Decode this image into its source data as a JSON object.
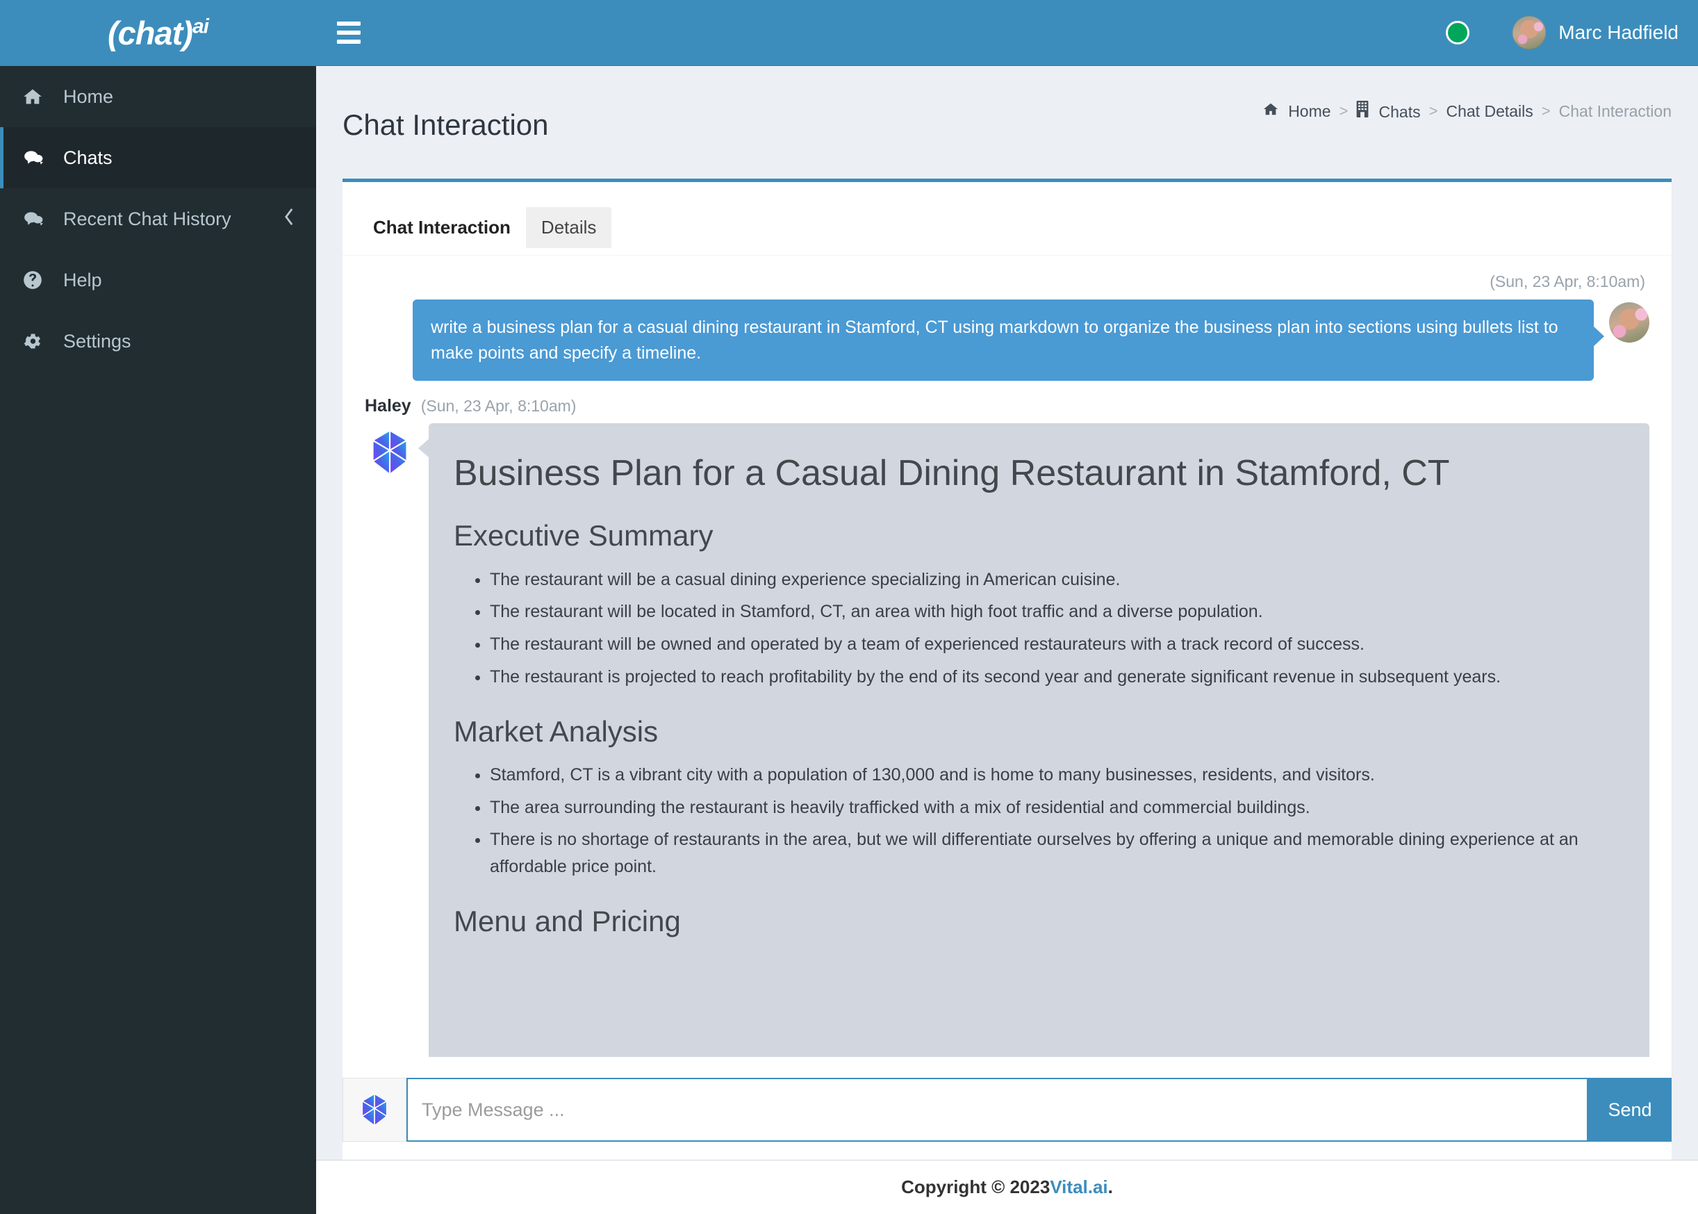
{
  "brand": {
    "logo_prefix": "(chat)",
    "logo_suffix": "ai"
  },
  "colors": {
    "header_blue": "#3c8dbc",
    "sidebar_dark": "#222d32",
    "sidebar_active": "#1e282c",
    "status_green": "#00a65a",
    "bubble_out": "#4a9ad4",
    "bubble_in": "#d2d6de",
    "page_bg": "#ecf0f5",
    "link_blue": "#3c8dbc"
  },
  "sidebar": {
    "items": [
      {
        "label": "Home",
        "icon": "home-icon",
        "active": false,
        "chevron": false
      },
      {
        "label": "Chats",
        "icon": "chats-icon",
        "active": true,
        "chevron": false
      },
      {
        "label": "Recent Chat History",
        "icon": "chat-history-icon",
        "active": false,
        "chevron": true
      },
      {
        "label": "Help",
        "icon": "help-circle-icon",
        "active": false,
        "chevron": false
      },
      {
        "label": "Settings",
        "icon": "gear-icon",
        "active": false,
        "chevron": false
      }
    ]
  },
  "topbar": {
    "menu_toggle": "hamburger-icon",
    "status": "online",
    "user_name": "Marc Hadfield"
  },
  "page": {
    "title": "Chat Interaction",
    "breadcrumb": [
      {
        "label": "Home",
        "icon": "home-icon",
        "current": false
      },
      {
        "label": "Chats",
        "icon": "building-icon",
        "current": false
      },
      {
        "label": "Chat Details",
        "icon": "",
        "current": false
      },
      {
        "label": "Chat Interaction",
        "icon": "",
        "current": true
      }
    ],
    "separator": ">"
  },
  "tabs": [
    {
      "label": "Chat Interaction",
      "active": true
    },
    {
      "label": "Details",
      "active": false
    }
  ],
  "conversation": {
    "user_message": {
      "timestamp": "(Sun, 23 Apr, 8:10am)",
      "text": "write a business plan for a casual dining restaurant in Stamford, CT using markdown to organize the business plan into sections using bullets list to make points and specify a timeline."
    },
    "bot_message": {
      "sender": "Haley",
      "timestamp": "(Sun, 23 Apr, 8:10am)",
      "avatar": "haley-polyhedron-logo",
      "title": "Business Plan for a Casual Dining Restaurant in Stamford, CT",
      "sections": [
        {
          "heading": "Executive Summary",
          "bullets": [
            "The restaurant will be a casual dining experience specializing in American cuisine.",
            "The restaurant will be located in Stamford, CT, an area with high foot traffic and a diverse population.",
            "The restaurant will be owned and operated by a team of experienced restaurateurs with a track record of success.",
            "The restaurant is projected to reach profitability by the end of its second year and generate significant revenue in subsequent years."
          ]
        },
        {
          "heading": "Market Analysis",
          "bullets": [
            "Stamford, CT is a vibrant city with a population of 130,000 and is home to many businesses, residents, and visitors.",
            "The area surrounding the restaurant is heavily trafficked with a mix of residential and commercial buildings.",
            "There is no shortage of restaurants in the area, but we will differentiate ourselves by offering a unique and memorable dining experience at an affordable price point."
          ]
        },
        {
          "heading": "Menu and Pricing",
          "bullets": []
        }
      ]
    }
  },
  "composer": {
    "logo_icon": "haley-polyhedron-logo",
    "placeholder": "Type Message ...",
    "value": "",
    "send_label": "Send"
  },
  "footer": {
    "copyright": "Copyright © 2023 ",
    "link_label": "Vital.ai",
    "suffix": "."
  }
}
